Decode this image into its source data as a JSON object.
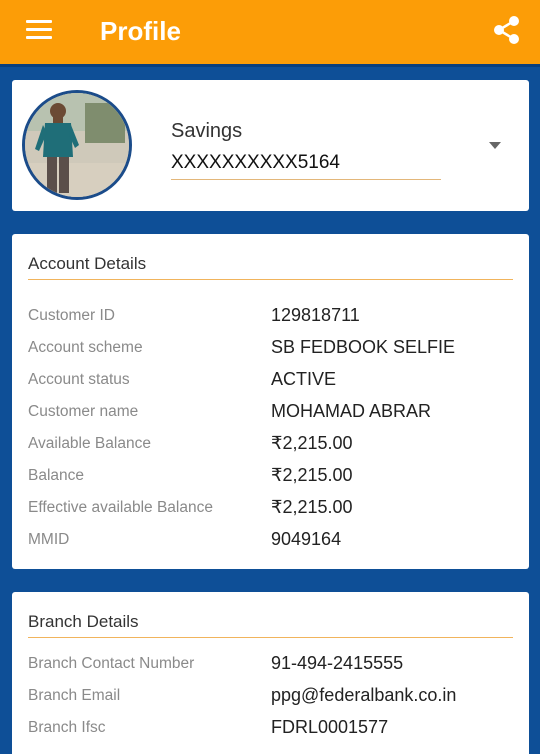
{
  "appbar": {
    "title": "Profile",
    "menu_icon": "hamburger-menu-icon",
    "share_icon": "share-icon",
    "background": "#fc9d07"
  },
  "profile": {
    "account_type": "Savings",
    "account_number": "XXXXXXXXXX5164"
  },
  "account_details": {
    "title": "Account Details",
    "rows": [
      {
        "label": "Customer ID",
        "value": "129818711"
      },
      {
        "label": "Account scheme",
        "value": "SB FEDBOOK SELFIE"
      },
      {
        "label": "Account status",
        "value": "ACTIVE"
      },
      {
        "label": "Customer name",
        "value": "MOHAMAD ABRAR"
      },
      {
        "label": "Available Balance",
        "value": "₹2,215.00"
      },
      {
        "label": "Balance",
        "value": "₹2,215.00"
      },
      {
        "label": "Effective available Balance",
        "value": "₹2,215.00"
      },
      {
        "label": "MMID",
        "value": "9049164"
      }
    ]
  },
  "branch_details": {
    "title": "Branch Details",
    "rows": [
      {
        "label": "Branch Contact Number",
        "value": "91-494-2415555"
      },
      {
        "label": "Branch Email",
        "value": "ppg@federalbank.co.in"
      },
      {
        "label": "Branch Ifsc",
        "value": "FDRL0001577"
      }
    ]
  },
  "colors": {
    "page_background": "#0e4f97",
    "accent": "#fc9d07",
    "section_rule": "#f1b45c"
  }
}
